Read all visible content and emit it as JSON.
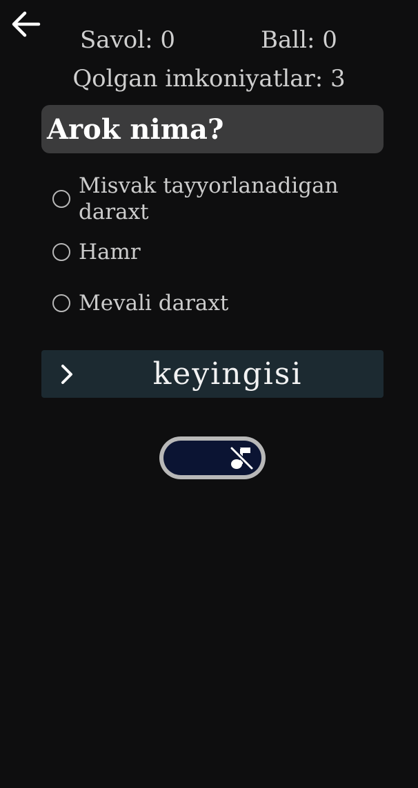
{
  "header": {
    "back_icon": "arrow-left-icon"
  },
  "stats": {
    "question_label": "Savol:",
    "question_value": "0",
    "score_label": "Ball:",
    "score_value": "0",
    "attempts_label": "Qolgan imkoniyatlar:",
    "attempts_value": "3"
  },
  "question": {
    "text": "Arok nima?"
  },
  "options": [
    {
      "label": "Misvak tayyorlanadigan daraxt",
      "selected": false
    },
    {
      "label": "Hamr",
      "selected": false
    },
    {
      "label": "Mevali daraxt",
      "selected": false
    }
  ],
  "next_button": {
    "label": "keyingisi",
    "icon": "chevron-right-icon"
  },
  "sound_toggle": {
    "state": "off",
    "icon": "music-off-icon"
  },
  "colors": {
    "background": "#0e0e0f",
    "question_box": "#3b3b3c",
    "next_button": "#1c2a31",
    "toggle_track": "#0b1433"
  }
}
